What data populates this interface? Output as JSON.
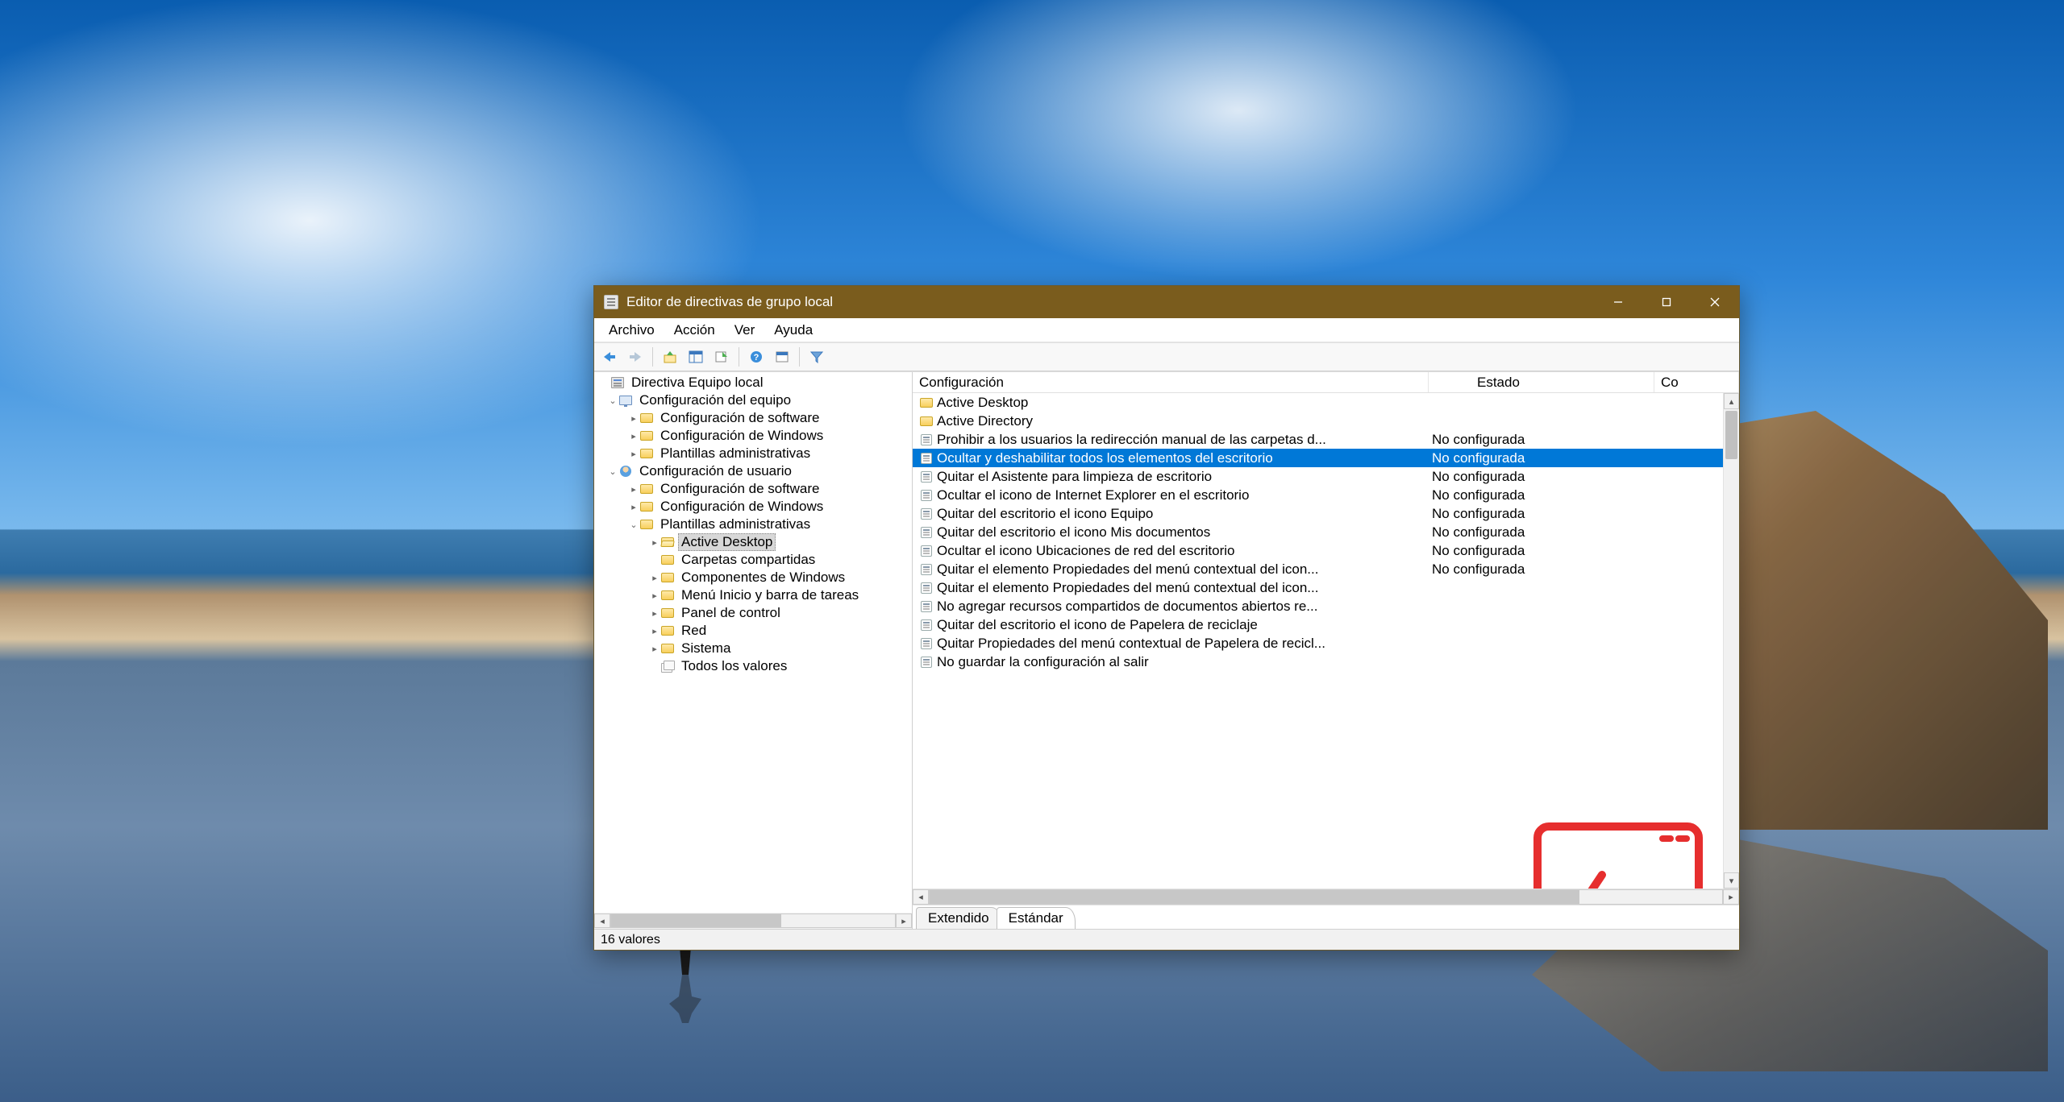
{
  "window": {
    "title": "Editor de directivas de grupo local"
  },
  "menu": {
    "file": "Archivo",
    "action": "Acción",
    "view": "Ver",
    "help": "Ayuda"
  },
  "tree": {
    "root": "Directiva Equipo local",
    "computer_config": "Configuración del equipo",
    "cc_software": "Configuración de software",
    "cc_windows": "Configuración de Windows",
    "cc_templates": "Plantillas administrativas",
    "user_config": "Configuración de usuario",
    "uc_software": "Configuración de software",
    "uc_windows": "Configuración de Windows",
    "uc_templates": "Plantillas administrativas",
    "active_desktop": "Active Desktop",
    "shared_folders": "Carpetas compartidas",
    "win_components": "Componentes de Windows",
    "start_taskbar": "Menú Inicio y barra de tareas",
    "control_panel": "Panel de control",
    "network": "Red",
    "system": "Sistema",
    "all_settings": "Todos los valores"
  },
  "columns": {
    "config": "Configuración",
    "state": "Estado",
    "comment": "Co"
  },
  "state_values": {
    "not_configured": "No configurada"
  },
  "list": [
    {
      "type": "folder",
      "label": "Active Desktop",
      "state": ""
    },
    {
      "type": "folder",
      "label": "Active Directory",
      "state": ""
    },
    {
      "type": "setting",
      "label": "Prohibir a los usuarios la redirección manual de las carpetas d...",
      "state": "No configurada"
    },
    {
      "type": "setting",
      "label": "Ocultar y deshabilitar todos los elementos del escritorio",
      "state": "No configurada",
      "selected": true
    },
    {
      "type": "setting",
      "label": "Quitar el Asistente para limpieza de escritorio",
      "state": "No configurada"
    },
    {
      "type": "setting",
      "label": "Ocultar el icono de Internet Explorer en el escritorio",
      "state": "No configurada"
    },
    {
      "type": "setting",
      "label": "Quitar del escritorio el icono Equipo",
      "state": "No configurada"
    },
    {
      "type": "setting",
      "label": "Quitar del escritorio el icono Mis documentos",
      "state": "No configurada"
    },
    {
      "type": "setting",
      "label": "Ocultar el icono Ubicaciones de red del escritorio",
      "state": "No configurada"
    },
    {
      "type": "setting",
      "label": "Quitar el elemento Propiedades del menú contextual del icon...",
      "state": "No configurada"
    },
    {
      "type": "setting",
      "label": "Quitar el elemento Propiedades del menú contextual del icon...",
      "state": ""
    },
    {
      "type": "setting",
      "label": "No agregar recursos compartidos de documentos abiertos re...",
      "state": ""
    },
    {
      "type": "setting",
      "label": "Quitar del escritorio el icono de Papelera de reciclaje",
      "state": ""
    },
    {
      "type": "setting",
      "label": "Quitar Propiedades del menú contextual de Papelera de recicl...",
      "state": ""
    },
    {
      "type": "setting",
      "label": "No guardar la configuración al salir",
      "state": ""
    }
  ],
  "tabs": {
    "extended": "Extendido",
    "standard": "Estándar"
  },
  "status": {
    "count": "16 valores"
  }
}
